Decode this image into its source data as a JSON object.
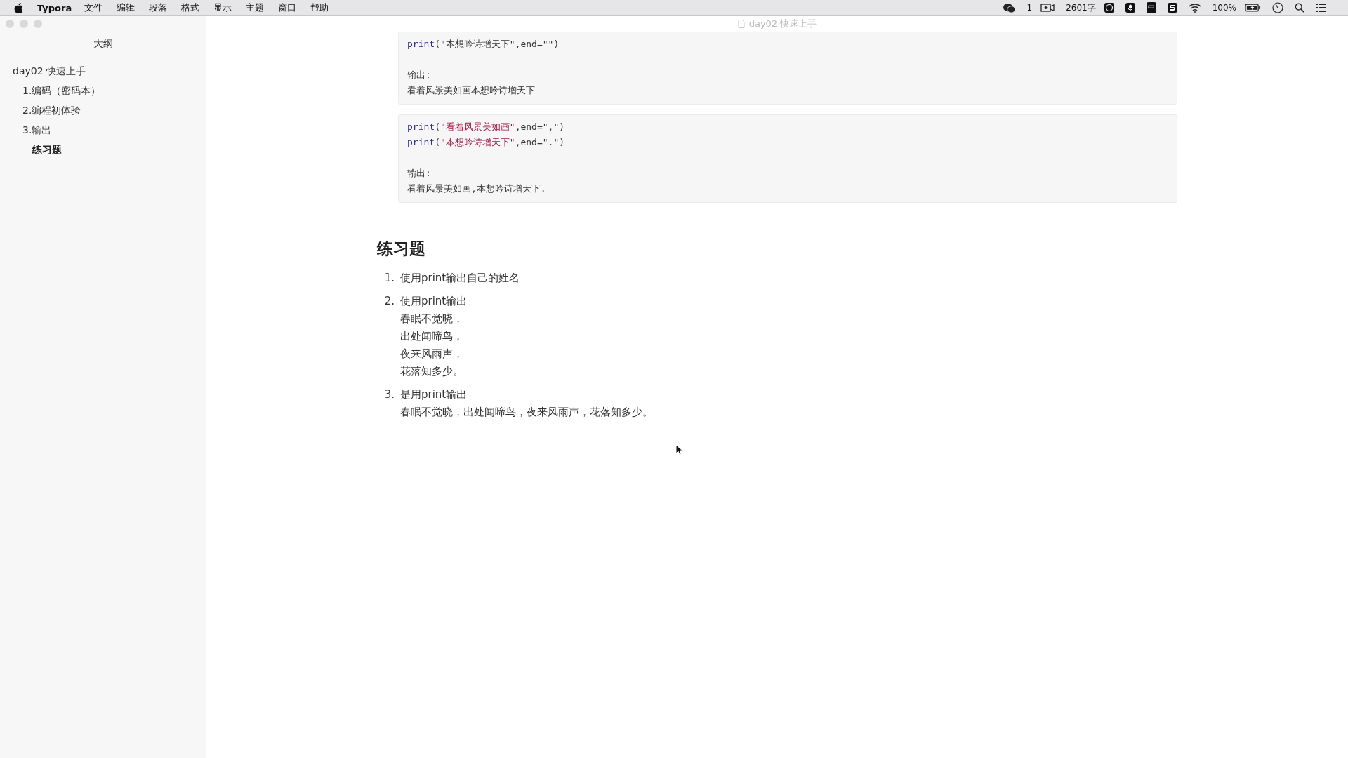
{
  "menu_bar": {
    "app_name": "Typora",
    "menus": [
      "文件",
      "编辑",
      "段落",
      "格式",
      "显示",
      "主题",
      "窗口",
      "帮助"
    ],
    "status": {
      "chat_count": "1",
      "word_count": "2601字",
      "input_method": "中",
      "battery": "100%"
    }
  },
  "window": {
    "title": "day02 快速上手"
  },
  "sidebar": {
    "title": "大纲",
    "items": [
      {
        "label": "day02 快速上手",
        "selected": false,
        "children": [
          {
            "label": "1.编码（密码本）",
            "selected": false
          },
          {
            "label": "2.编程初体验",
            "selected": false
          },
          {
            "label": "3.输出",
            "selected": false,
            "children": [
              {
                "label": "练习题",
                "selected": true
              }
            ]
          }
        ]
      }
    ]
  },
  "document": {
    "code_blocks": [
      {
        "code": [
          [
            {
              "kind": "keyword",
              "text": "print"
            },
            {
              "kind": "plain",
              "text": "(\"本想吟诗增天下\",end=\"\")"
            }
          ]
        ],
        "output": [
          "输出:",
          "看着风景美如画本想吟诗增天下"
        ]
      },
      {
        "code": [
          [
            {
              "kind": "keyword",
              "text": "print"
            },
            {
              "kind": "plain",
              "text": "("
            },
            {
              "kind": "string",
              "text": "\"看着风景美如画\""
            },
            {
              "kind": "plain",
              "text": ",end=\",\")"
            }
          ],
          [
            {
              "kind": "keyword",
              "text": "print"
            },
            {
              "kind": "plain",
              "text": "("
            },
            {
              "kind": "string",
              "text": "\"本想吟诗增天下\""
            },
            {
              "kind": "plain",
              "text": ",end=\".\")"
            }
          ]
        ],
        "output": [
          "输出:",
          "看着风景美如画,本想吟诗增天下."
        ]
      }
    ],
    "heading": "练习题",
    "exercises": [
      {
        "number": "1.",
        "title": "使用print输出自己的姓名"
      },
      {
        "number": "2.",
        "title": "使用print输出",
        "lines": [
          "春眠不觉晓，",
          "出处闻啼鸟，",
          "夜来风雨声，",
          "花落知多少。"
        ]
      },
      {
        "number": "3.",
        "title": "是用print输出",
        "lines": [
          "春眠不觉晓，出处闻啼鸟，夜来风雨声，花落知多少。"
        ]
      }
    ]
  }
}
